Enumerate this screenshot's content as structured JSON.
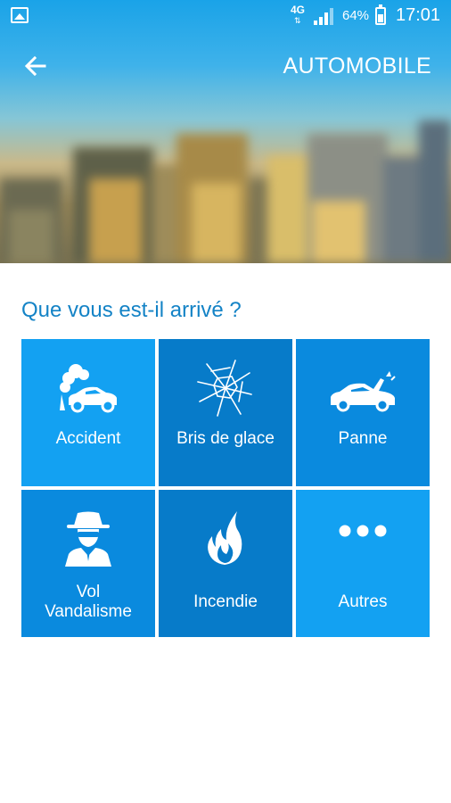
{
  "status_bar": {
    "network": "4G",
    "battery_percent": "64%",
    "time": "17:01"
  },
  "header": {
    "title": "AUTOMOBILE"
  },
  "question": "Que vous est-il arrivé ?",
  "tiles": [
    {
      "label": "Accident",
      "icon": "car-crash-icon",
      "color": "#13a1f2"
    },
    {
      "label": "Bris de glace",
      "icon": "broken-glass-icon",
      "color": "#077bc9"
    },
    {
      "label": "Panne",
      "icon": "car-breakdown-icon",
      "color": "#0a8ade"
    },
    {
      "label": "Vol\nVandalisme",
      "label_line1": "Vol",
      "label_line2": "Vandalisme",
      "icon": "thief-icon",
      "color": "#0a8ade"
    },
    {
      "label": "Incendie",
      "icon": "fire-icon",
      "color": "#077bc9"
    },
    {
      "label": "Autres",
      "icon": "more-dots-icon",
      "color": "#13a1f2"
    }
  ]
}
